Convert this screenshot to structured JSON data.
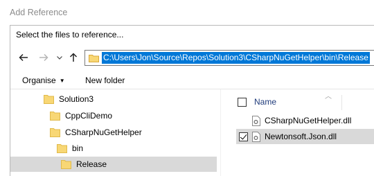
{
  "window": {
    "title": "Add Reference"
  },
  "dialog": {
    "title": "Select the files to reference...",
    "address": "C:\\Users\\Jon\\Source\\Repos\\Solution3\\CSharpNuGetHelper\\bin\\Release"
  },
  "toolbar": {
    "organise_label": "Organise",
    "new_folder_label": "New folder"
  },
  "tree": {
    "items": [
      {
        "label": "Solution3",
        "selected": false
      },
      {
        "label": "CppCliDemo",
        "selected": false
      },
      {
        "label": "CSharpNuGetHelper",
        "selected": false
      },
      {
        "label": "bin",
        "selected": false
      },
      {
        "label": "Release",
        "selected": true
      }
    ]
  },
  "files": {
    "column_name": "Name",
    "items": [
      {
        "label": "CSharpNuGetHelper.dll",
        "checked": false,
        "selected": false
      },
      {
        "label": "Newtonsoft.Json.dll",
        "checked": true,
        "selected": true
      }
    ]
  },
  "colors": {
    "selection": "#0078d7",
    "row_selected": "#d9d9d9",
    "folder": "#f8d775"
  }
}
